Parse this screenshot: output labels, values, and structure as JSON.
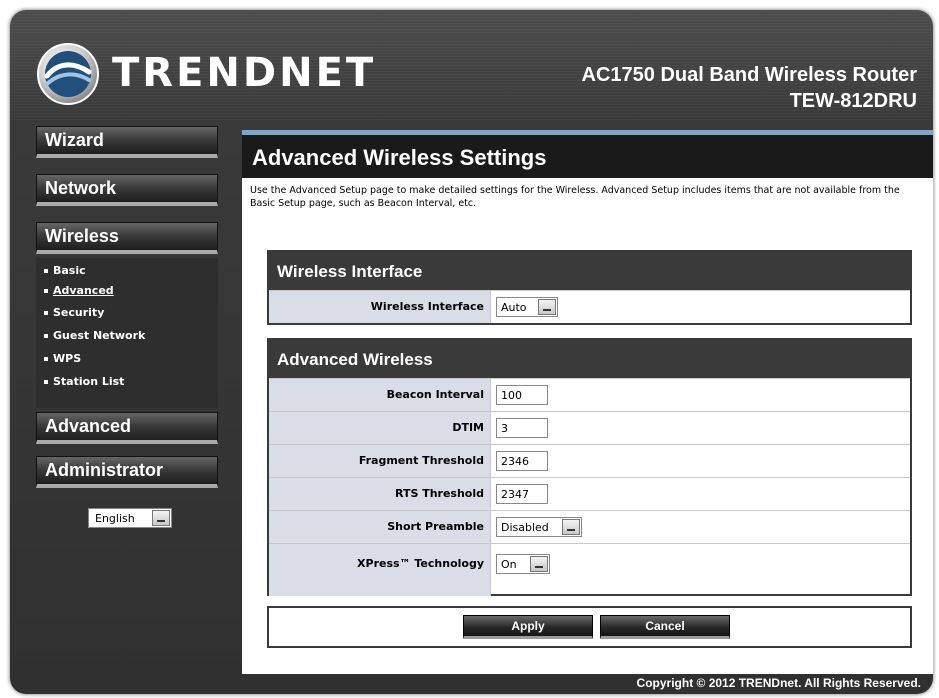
{
  "header": {
    "brand": "TRENDNET",
    "product_line1": "AC1750 Dual Band Wireless Router",
    "product_line2": "TEW-812DRU"
  },
  "sidebar": {
    "menu": [
      {
        "label": "Wizard"
      },
      {
        "label": "Network"
      },
      {
        "label": "Wireless"
      },
      {
        "label": "Advanced"
      },
      {
        "label": "Administrator"
      }
    ],
    "wireless_submenu": [
      {
        "label": "Basic",
        "active": false
      },
      {
        "label": "Advanced",
        "active": true
      },
      {
        "label": "Security",
        "active": false
      },
      {
        "label": "Guest Network",
        "active": false
      },
      {
        "label": "WPS",
        "active": false
      },
      {
        "label": "Station List",
        "active": false
      }
    ],
    "language": "English"
  },
  "main": {
    "title": "Advanced Wireless Settings",
    "description": "Use the Advanced Setup page to make detailed settings for the Wireless. Advanced Setup includes items that are not available from the Basic Setup page, such as Beacon Interval, etc.",
    "wireless_interface_section": {
      "heading": "Wireless Interface",
      "row_label": "Wireless Interface",
      "value": "Auto"
    },
    "advanced_section": {
      "heading": "Advanced Wireless",
      "beacon_interval": {
        "label": "Beacon Interval",
        "value": "100"
      },
      "dtim": {
        "label": "DTIM",
        "value": "3"
      },
      "fragment_threshold": {
        "label": "Fragment Threshold",
        "value": "2346"
      },
      "rts_threshold": {
        "label": "RTS Threshold",
        "value": "2347"
      },
      "short_preamble": {
        "label": "Short Preamble",
        "value": "Disabled"
      },
      "xpress": {
        "label": "XPress™ Technology",
        "value": "On"
      }
    },
    "buttons": {
      "apply": "Apply",
      "cancel": "Cancel"
    }
  },
  "footer": {
    "copyright": "Copyright © 2012 TRENDnet. All Rights Reserved."
  },
  "colors": {
    "header_bg": "#3a3a3a",
    "title_bar": "#1a1a1a",
    "accent_line": "#7ea6c8",
    "label_cell": "#d8dde6",
    "section_head": "#3a3a3a"
  }
}
